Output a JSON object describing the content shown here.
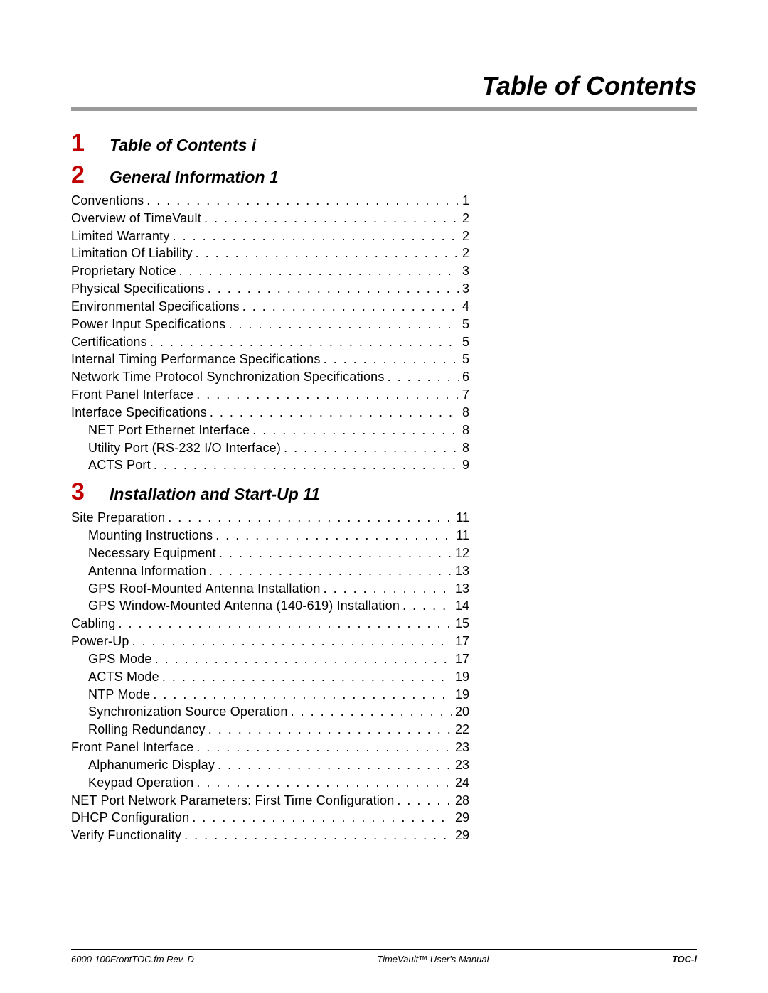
{
  "title": "Table of Contents",
  "sections": [
    {
      "num": "1",
      "title": "Table of Contents i",
      "entries": []
    },
    {
      "num": "2",
      "title": "General Information 1",
      "entries": [
        {
          "label": "Conventions",
          "page": "1",
          "sub": false
        },
        {
          "label": "Overview of TimeVault",
          "page": "2",
          "sub": false
        },
        {
          "label": "Limited Warranty",
          "page": "2",
          "sub": false
        },
        {
          "label": "Limitation Of Liability",
          "page": "2",
          "sub": false
        },
        {
          "label": "Proprietary Notice",
          "page": "3",
          "sub": false
        },
        {
          "label": "Physical Specifications",
          "page": "3",
          "sub": false
        },
        {
          "label": "Environmental Specifications",
          "page": "4",
          "sub": false
        },
        {
          "label": "Power Input Specifications",
          "page": "5",
          "sub": false
        },
        {
          "label": "Certifications",
          "page": "5",
          "sub": false
        },
        {
          "label": "Internal Timing Performance Specifications",
          "page": "5",
          "sub": false
        },
        {
          "label": "Network Time Protocol Synchronization Specifications",
          "page": "6",
          "sub": false
        },
        {
          "label": "Front Panel Interface",
          "page": "7",
          "sub": false
        },
        {
          "label": "Interface Specifications",
          "page": "8",
          "sub": false
        },
        {
          "label": "NET Port Ethernet Interface",
          "page": "8",
          "sub": true
        },
        {
          "label": "Utility Port (RS-232 I/O Interface)",
          "page": "8",
          "sub": true
        },
        {
          "label": "ACTS Port",
          "page": "9",
          "sub": true
        }
      ]
    },
    {
      "num": "3",
      "title": "Installation and Start-Up 11",
      "entries": [
        {
          "label": "Site Preparation",
          "page": "11",
          "sub": false
        },
        {
          "label": "Mounting Instructions",
          "page": "11",
          "sub": true
        },
        {
          "label": "Necessary Equipment",
          "page": "12",
          "sub": true
        },
        {
          "label": "Antenna Information",
          "page": "13",
          "sub": true
        },
        {
          "label": "GPS Roof-Mounted Antenna Installation",
          "page": "13",
          "sub": true
        },
        {
          "label": "GPS Window-Mounted Antenna (140-619) Installation",
          "page": "14",
          "sub": true
        },
        {
          "label": "Cabling",
          "page": "15",
          "sub": false
        },
        {
          "label": "Power-Up",
          "page": "17",
          "sub": false
        },
        {
          "label": "GPS Mode",
          "page": "17",
          "sub": true
        },
        {
          "label": "ACTS Mode",
          "page": "19",
          "sub": true
        },
        {
          "label": "NTP Mode",
          "page": "19",
          "sub": true
        },
        {
          "label": "Synchronization Source Operation",
          "page": "20",
          "sub": true
        },
        {
          "label": "Rolling Redundancy",
          "page": "22",
          "sub": true
        },
        {
          "label": "Front Panel Interface",
          "page": "23",
          "sub": false
        },
        {
          "label": "Alphanumeric Display",
          "page": "23",
          "sub": true
        },
        {
          "label": "Keypad Operation",
          "page": "24",
          "sub": true
        },
        {
          "label": "NET Port Network Parameters: First Time Configuration",
          "page": "28",
          "sub": false
        },
        {
          "label": "DHCP Configuration",
          "page": "29",
          "sub": false
        },
        {
          "label": "Verify Functionality",
          "page": "29",
          "sub": false
        }
      ]
    }
  ],
  "footer": {
    "left": "6000-100FrontTOC.fm Rev. D",
    "center": "TimeVault™ User's Manual",
    "right": "TOC-i"
  }
}
